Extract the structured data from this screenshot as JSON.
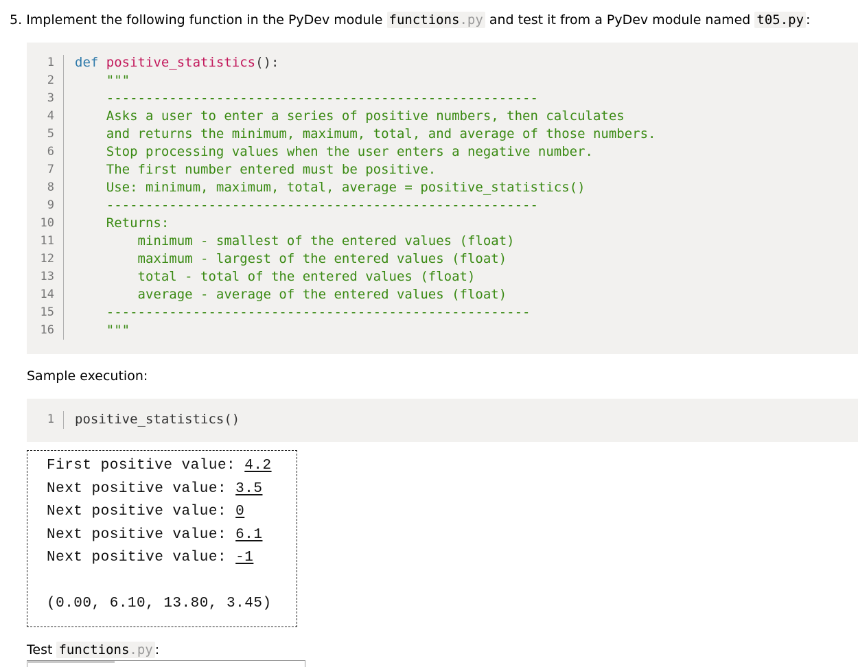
{
  "question": {
    "number": "5.",
    "text_before": "Implement the following function in the PyDev module",
    "module_name": "functions",
    "module_ext": ".py",
    "text_middle": "and test it from a PyDev module named",
    "test_module": "t05.py",
    "text_end": ":"
  },
  "code_block": {
    "line_numbers": [
      "1",
      "2",
      "3",
      "4",
      "5",
      "6",
      "7",
      "8",
      "9",
      "10",
      "11",
      "12",
      "13",
      "14",
      "15",
      "16"
    ],
    "def_keyword": "def",
    "function_name": "positive_statistics",
    "signature_end": "():",
    "lines": [
      "    \"\"\"",
      "    -------------------------------------------------------",
      "    Asks a user to enter a series of positive numbers, then calculates",
      "    and returns the minimum, maximum, total, and average of those numbers.",
      "    Stop processing values when the user enters a negative number.",
      "    The first number entered must be positive.",
      "    Use: minimum, maximum, total, average = positive_statistics()",
      "    -------------------------------------------------------",
      "    Returns:",
      "        minimum - smallest of the entered values (float)",
      "        maximum - largest of the entered values (float)",
      "        total - total of the entered values (float)",
      "        average - average of the entered values (float)",
      "    ------------------------------------------------------",
      "    \"\"\""
    ]
  },
  "sample_label": "Sample execution:",
  "sample_code": {
    "line_number": "1",
    "call": "positive_statistics()"
  },
  "console": {
    "prompts": [
      {
        "prompt": "First positive value: ",
        "value": "4.2"
      },
      {
        "prompt": "Next positive value: ",
        "value": "3.5"
      },
      {
        "prompt": "Next positive value: ",
        "value": "0"
      },
      {
        "prompt": "Next positive value: ",
        "value": "6.1"
      },
      {
        "prompt": "Next positive value: ",
        "value": "-1"
      }
    ],
    "result": "(0.00, 6.10, 13.80, 3.45)"
  },
  "test_label": {
    "prefix": "Test",
    "module_name": "functions",
    "module_ext": ".py",
    "suffix": ":"
  },
  "colors": {
    "code_background": "#f2f1ef",
    "docstring": "#3a8a13",
    "keyword": "#2f7aaa",
    "function_name": "#c2185b"
  }
}
